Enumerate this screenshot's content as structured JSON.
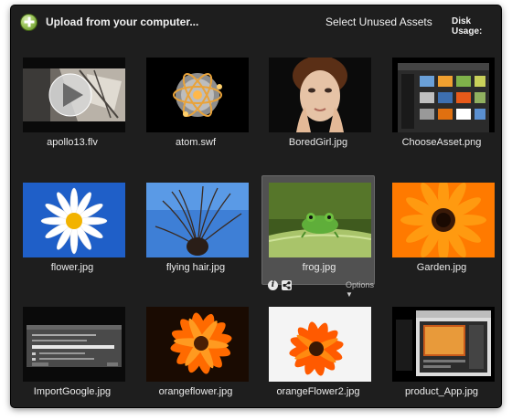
{
  "toolbar": {
    "upload_label": "Upload from your computer...",
    "select_unused_label": "Select Unused Assets",
    "disk_usage_label": "Disk Usage:"
  },
  "assets": [
    {
      "name": "apollo13.flv"
    },
    {
      "name": "atom.swf"
    },
    {
      "name": "BoredGirl.jpg"
    },
    {
      "name": "ChooseAsset.png"
    },
    {
      "name": "flower.jpg"
    },
    {
      "name": "flying hair.jpg"
    },
    {
      "name": "frog.jpg",
      "selected": true
    },
    {
      "name": "Garden.jpg"
    },
    {
      "name": "ImportGoogle.jpg"
    },
    {
      "name": "orangeflower.jpg"
    },
    {
      "name": "orangeFlower2.jpg"
    },
    {
      "name": "product_App.jpg"
    }
  ],
  "selected_tools": {
    "options_label": "Options"
  },
  "colors": {
    "window_bg": "#1e1e1e",
    "selected_tile_bg": "#515151",
    "plus_green": "#8ab84a"
  }
}
